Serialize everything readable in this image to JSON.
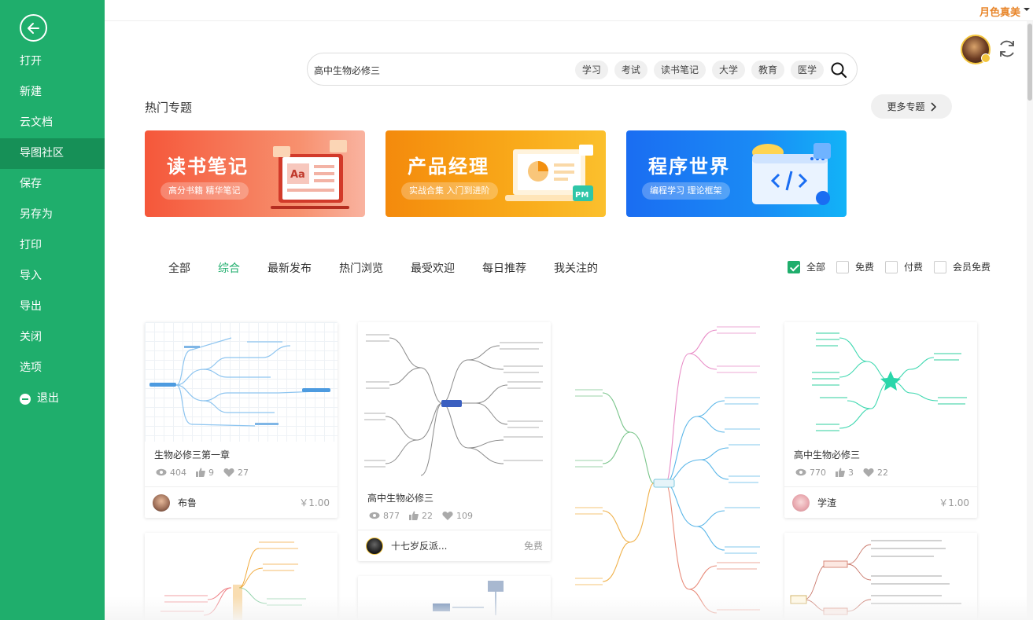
{
  "sidebar": {
    "items": [
      {
        "label": "打开"
      },
      {
        "label": "新建"
      },
      {
        "label": "云文档"
      },
      {
        "label": "导图社区",
        "active": true
      },
      {
        "label": "保存"
      },
      {
        "label": "另存为"
      },
      {
        "label": "打印"
      },
      {
        "label": "导入"
      },
      {
        "label": "导出"
      },
      {
        "label": "关闭"
      },
      {
        "label": "选项"
      },
      {
        "label": "退出"
      }
    ]
  },
  "header": {
    "user_name": "月色真美"
  },
  "search": {
    "value": "高中生物必修三",
    "tags": [
      "学习",
      "考试",
      "读书笔记",
      "大学",
      "教育",
      "医学"
    ]
  },
  "hot": {
    "title": "热门专题",
    "more_label": "更多专题",
    "cards": [
      {
        "title": "读书笔记",
        "subtitle": "高分书籍 精华笔记"
      },
      {
        "title": "产品经理",
        "subtitle": "实战合集 入门到进阶"
      },
      {
        "title": "程序世界",
        "subtitle": "编程学习 理论框架"
      }
    ]
  },
  "tabs": [
    "全部",
    "综合",
    "最新发布",
    "热门浏览",
    "最受欢迎",
    "每日推荐",
    "我关注的"
  ],
  "active_tab": "综合",
  "price_filters": [
    {
      "label": "全部",
      "checked": true
    },
    {
      "label": "免费",
      "checked": false
    },
    {
      "label": "付费",
      "checked": false
    },
    {
      "label": "会员免费",
      "checked": false
    }
  ],
  "cards": [
    {
      "title": "生物必修三第一章",
      "views": "404",
      "likes": "9",
      "favs": "27",
      "author": "布鲁",
      "price": "￥1.00"
    },
    {
      "title": "高中生物必修三",
      "views": "877",
      "likes": "22",
      "favs": "109",
      "author": "十七岁反派...",
      "price": "免费"
    },
    {
      "title": "高中生物必修三",
      "views": "770",
      "likes": "3",
      "favs": "22",
      "author": "学渣",
      "price": "￥1.00"
    }
  ],
  "colors": {
    "brand": "#1fae6c",
    "user": "#e8862b"
  }
}
